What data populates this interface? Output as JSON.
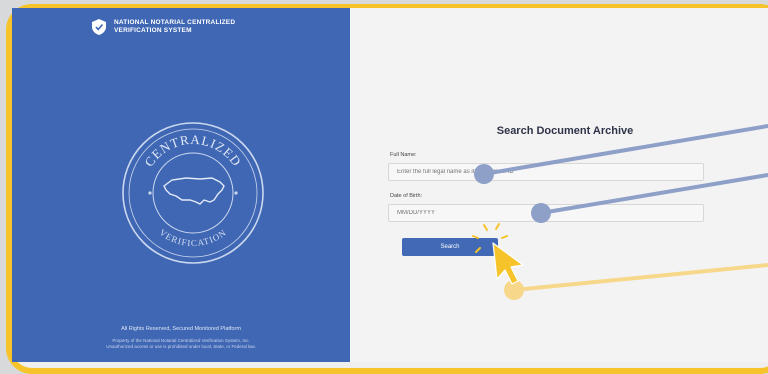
{
  "brand": {
    "line1": "NATIONAL NOTARIAL CENTRALIZED",
    "line2": "VERIFICATION SYSTEM"
  },
  "seal": {
    "top_text": "CENTRALIZED",
    "bottom_text": "VERIFICATION"
  },
  "footer": {
    "rights": "All Rights Reserved, Secured Monitored Platform",
    "notice_line1": "Property of the National Notarial Centralized Verification System, Inc.",
    "notice_line2": "Unauthorized access or use is prohibited under local, State, or Federal law."
  },
  "form": {
    "title": "Search Document Archive",
    "full_name_label": "Full Name:",
    "full_name_placeholder": "Enter the full legal name as it appears on ID",
    "dob_label": "Date of Birth:",
    "dob_placeholder": "MM/DD/YYYY",
    "search_label": "Search"
  },
  "colors": {
    "panel_blue": "#3f67b4",
    "frame_yellow": "#f6c42a",
    "button_blue": "#4169b5"
  }
}
